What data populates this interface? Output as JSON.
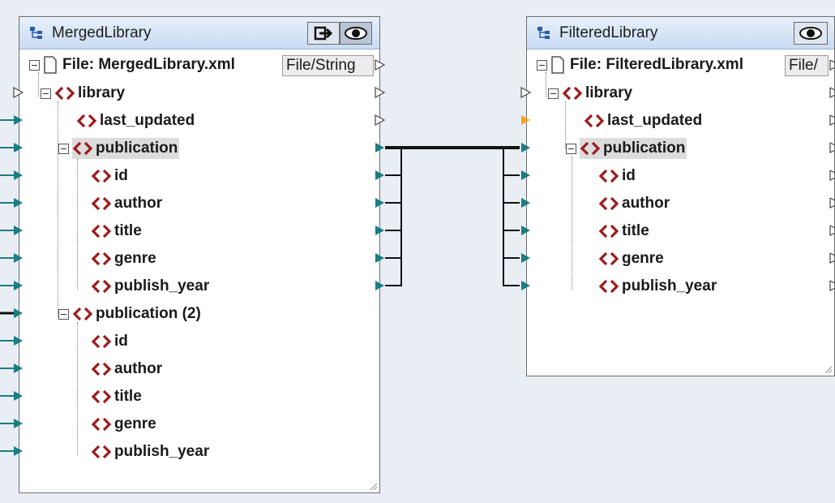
{
  "left_component": {
    "title": "MergedLibrary",
    "file_label": "File: MergedLibrary.xml",
    "file_button": "File/String",
    "tree": [
      {
        "label": "library"
      },
      {
        "label": "last_updated"
      },
      {
        "label": "publication"
      },
      {
        "label": "id"
      },
      {
        "label": "author"
      },
      {
        "label": "title"
      },
      {
        "label": "genre"
      },
      {
        "label": "publish_year"
      },
      {
        "label": "publication (2)"
      },
      {
        "label": "id"
      },
      {
        "label": "author"
      },
      {
        "label": "title"
      },
      {
        "label": "genre"
      },
      {
        "label": "publish_year"
      }
    ]
  },
  "right_component": {
    "title": "FilteredLibrary",
    "file_label": "File: FilteredLibrary.xml",
    "file_button": "File/",
    "tree": [
      {
        "label": "library"
      },
      {
        "label": "last_updated"
      },
      {
        "label": "publication"
      },
      {
        "label": "id"
      },
      {
        "label": "author"
      },
      {
        "label": "title"
      },
      {
        "label": "genre"
      },
      {
        "label": "publish_year"
      }
    ]
  },
  "colors": {
    "connector_teal": "#1a7d82",
    "connector_orange": "#f2a928",
    "element_icon_red": "#9b1c1c",
    "canvas": "#e9eef5"
  },
  "icons": {
    "component": "tree-icon",
    "output_toggle": "output-icon",
    "preview": "eye-icon",
    "file": "document-icon",
    "element": "xml-element-icon"
  }
}
